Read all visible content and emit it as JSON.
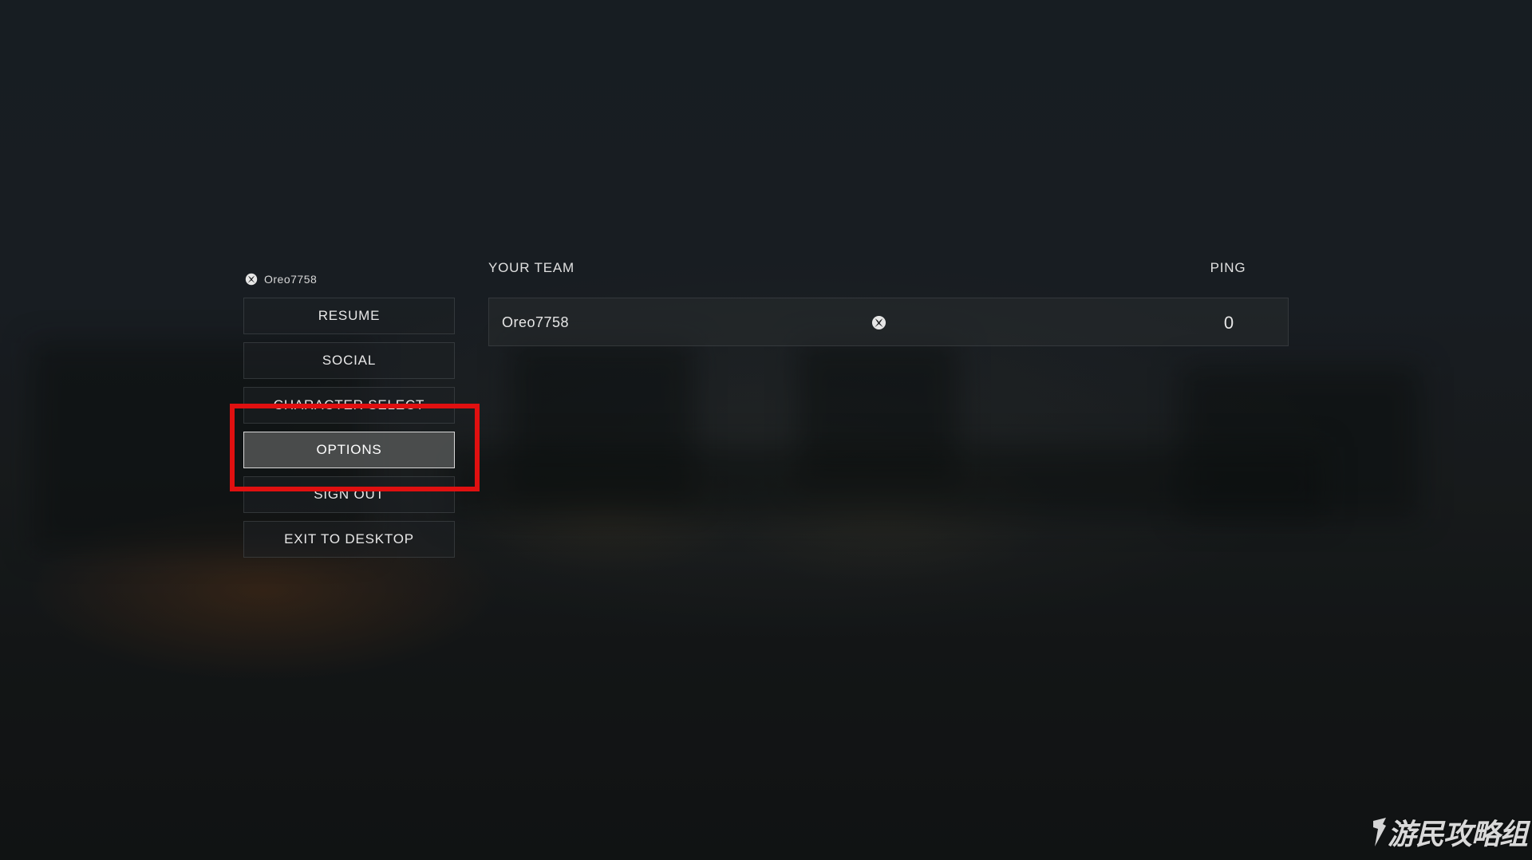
{
  "player": {
    "gamertag": "Oreo7758",
    "platform_icon": "xbox-icon"
  },
  "menu": {
    "items": [
      {
        "label": "RESUME"
      },
      {
        "label": "SOCIAL"
      },
      {
        "label": "CHARACTER SELECT"
      },
      {
        "label": "OPTIONS"
      },
      {
        "label": "SIGN OUT"
      },
      {
        "label": "EXIT TO DESKTOP"
      }
    ],
    "selected": "OPTIONS"
  },
  "team": {
    "header": "YOUR TEAM",
    "ping_header": "PING",
    "members": [
      {
        "name": "Oreo7758",
        "platform_icon": "xbox-icon",
        "ping": "0"
      }
    ]
  },
  "annotation": {
    "highlight_color": "#e01010"
  },
  "watermark": {
    "text": "游民攻略组"
  },
  "colors": {
    "text": "#e8e8e8",
    "selected_bg": "#4e5050",
    "panel_bg": "#282b2e"
  }
}
